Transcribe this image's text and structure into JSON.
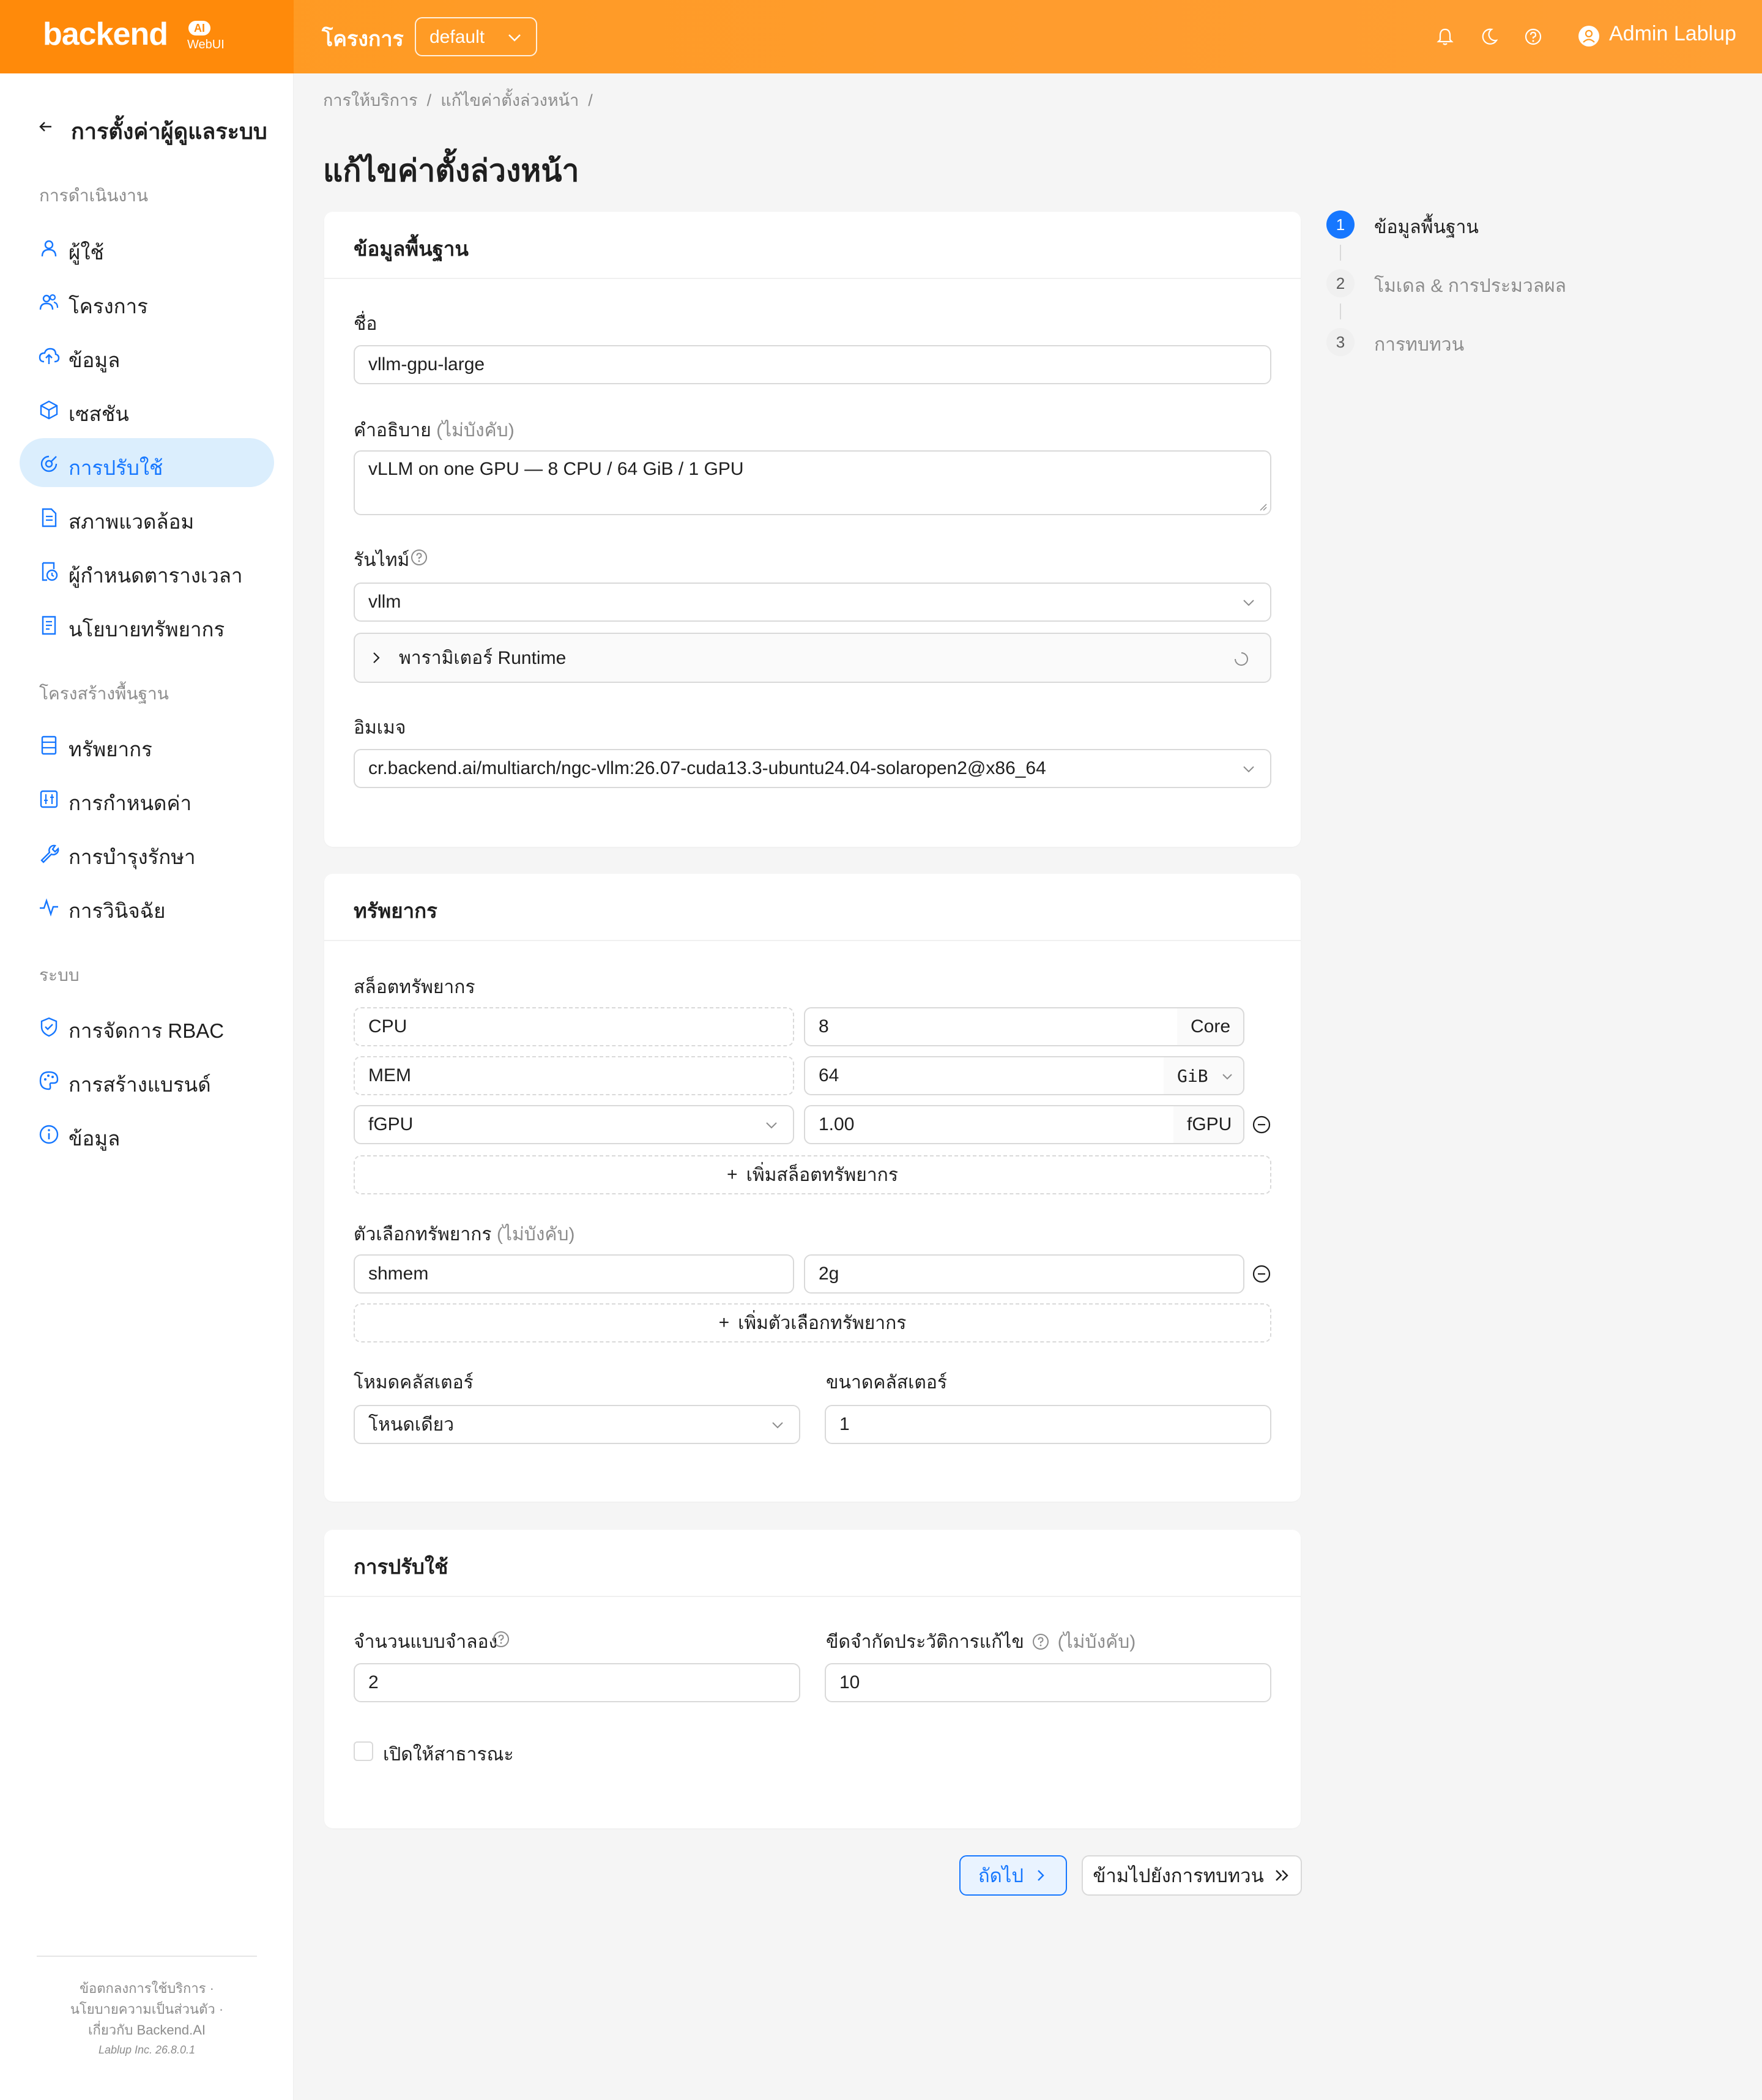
{
  "header": {
    "logo_text": "backend",
    "logo_badge": "AI",
    "logo_sub": "WebUI",
    "project_label": "โครงการ",
    "project_value": "default",
    "user_name": "Admin Lablup"
  },
  "sidebar": {
    "back_title": "การตั้งค่าผู้ดูแลระบบ",
    "sections": {
      "operations": "การดำเนินงาน",
      "infrastructure": "โครงสร้างพื้นฐาน",
      "system": "ระบบ"
    },
    "items": [
      {
        "label": "ผู้ใช้",
        "icon": "user-icon"
      },
      {
        "label": "โครงการ",
        "icon": "team-icon"
      },
      {
        "label": "ข้อมูล",
        "icon": "cloud-upload-icon"
      },
      {
        "label": "เซสชัน",
        "icon": "cube-icon"
      },
      {
        "label": "การปรับใช้",
        "icon": "deploy-icon",
        "active": true
      },
      {
        "label": "สภาพแวดล้อม",
        "icon": "file-icon"
      },
      {
        "label": "ผู้กำหนดตารางเวลา",
        "icon": "schedule-icon"
      },
      {
        "label": "นโยบายทรัพยากร",
        "icon": "policy-icon"
      },
      {
        "label": "ทรัพยากร",
        "icon": "resource-icon"
      },
      {
        "label": "การกำหนดค่า",
        "icon": "config-icon"
      },
      {
        "label": "การบำรุงรักษา",
        "icon": "tool-icon"
      },
      {
        "label": "การวินิจฉัย",
        "icon": "pulse-icon"
      },
      {
        "label": "การจัดการ RBAC",
        "icon": "shield-icon"
      },
      {
        "label": "การสร้างแบรนด์",
        "icon": "palette-icon"
      },
      {
        "label": "ข้อมูล",
        "icon": "info-icon"
      }
    ],
    "footer": {
      "line1": "ข้อตกลงการใช้บริการ ·",
      "line2": "นโยบายความเป็นส่วนตัว ·",
      "line3": "เกี่ยวกับ Backend.AI",
      "line4": "Lablup Inc. 26.8.0.1"
    }
  },
  "breadcrumb": {
    "item1": "การให้บริการ",
    "sep": "/",
    "item2": "แก้ไขค่าตั้งล่วงหน้า"
  },
  "page_title": "แก้ไขค่าตั้งล่วงหน้า",
  "basic": {
    "title": "ข้อมูลพื้นฐาน",
    "name_label": "ชื่อ",
    "name_value": "vllm-gpu-large",
    "desc_label": "คำอธิบาย",
    "optional": "(ไม่บังคับ)",
    "desc_value": "vLLM on one GPU — 8 CPU / 64 GiB / 1 GPU",
    "runtime_label": "รันไทม์",
    "runtime_value": "vllm",
    "runtime_params": "พารามิเตอร์ Runtime",
    "image_label": "อิมเมจ",
    "image_value": "cr.backend.ai/multiarch/ngc-vllm:26.07-cuda13.3-ubuntu24.04-solaropen2@x86_64"
  },
  "resources": {
    "title": "ทรัพยากร",
    "slots_label": "สล็อตทรัพยากร",
    "slots": [
      {
        "name": "CPU",
        "value": "8",
        "unit": "Core"
      },
      {
        "name": "MEM",
        "value": "64",
        "unit": "GiB"
      },
      {
        "name": "fGPU",
        "value": "1.00",
        "unit": "fGPU"
      }
    ],
    "add_slot": "เพิ่มสล็อตทรัพยากร",
    "options_label": "ตัวเลือกทรัพยากร",
    "optional": "(ไม่บังคับ)",
    "option_key": "shmem",
    "option_value": "2g",
    "add_option": "เพิ่มตัวเลือกทรัพยากร",
    "cluster_mode_label": "โหมดคลัสเตอร์",
    "cluster_mode_value": "โหนดเดียว",
    "cluster_size_label": "ขนาดคลัสเตอร์",
    "cluster_size_value": "1"
  },
  "deployment": {
    "title": "การปรับใช้",
    "replicas_label": "จำนวนแบบจำลอง",
    "replicas_value": "2",
    "history_label": "ขีดจำกัดประวัติการแก้ไข",
    "optional": "(ไม่บังคับ)",
    "history_value": "10",
    "public_label": "เปิดให้สาธารณะ"
  },
  "steps": [
    {
      "num": "1",
      "label": "ข้อมูลพื้นฐาน"
    },
    {
      "num": "2",
      "label": "โมเดล & การประมวลผล"
    },
    {
      "num": "3",
      "label": "การทบทวน"
    }
  ],
  "buttons": {
    "next": "ถัดไป",
    "skip": "ข้ามไปยังการทบทวน"
  }
}
